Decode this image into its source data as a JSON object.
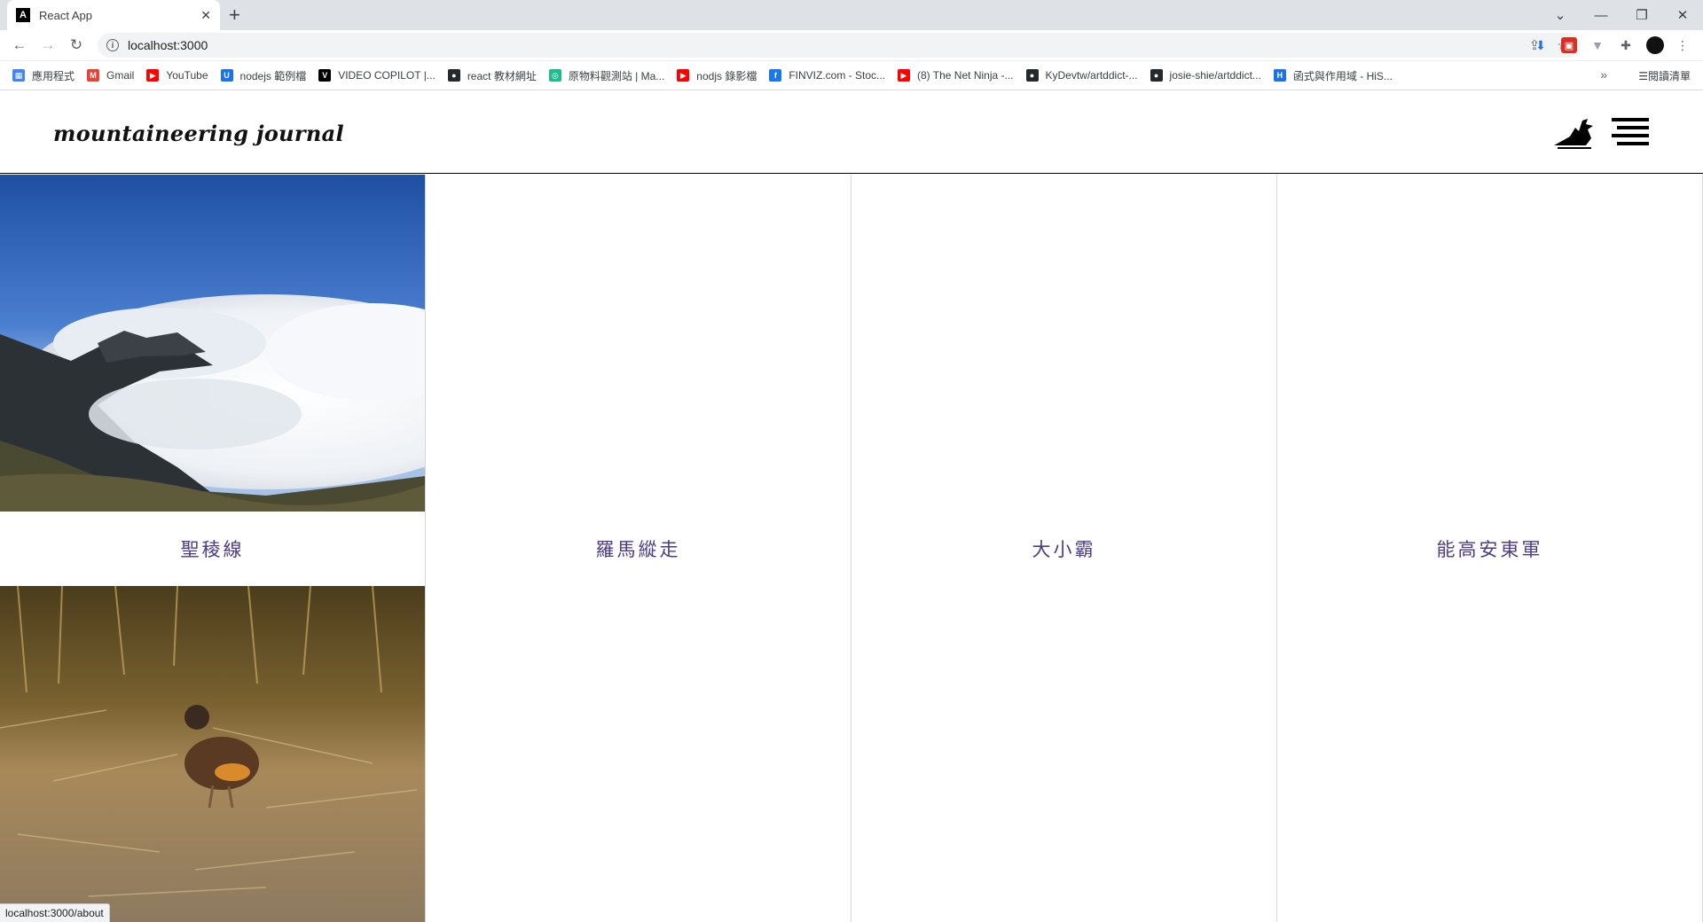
{
  "browser": {
    "tab_title": "React App",
    "tab_favicon_letter": "A",
    "url": "localhost:3000",
    "bookmarks": [
      {
        "label": "應用程式",
        "icon": "apps-grid-icon",
        "color": "#4285f4"
      },
      {
        "label": "Gmail",
        "icon": "gmail-icon",
        "color": "#ea4335"
      },
      {
        "label": "YouTube",
        "icon": "youtube-icon",
        "color": "#ff0000"
      },
      {
        "label": "nodejs 範例檔",
        "icon": "u-icon",
        "color": "#1a73e8"
      },
      {
        "label": "VIDEO COPILOT |...",
        "icon": "v-logo-icon",
        "color": "#000000"
      },
      {
        "label": "react 教材網址",
        "icon": "github-icon",
        "color": "#24292e"
      },
      {
        "label": "原物料觀測站 | Ma...",
        "icon": "ma-icon",
        "color": "#1ebc8c"
      },
      {
        "label": "nodjs 錄影檔",
        "icon": "youtube-icon",
        "color": "#ff0000"
      },
      {
        "label": "FINVIZ.com - Stoc...",
        "icon": "facebook-icon",
        "color": "#1877f2"
      },
      {
        "label": "(8) The Net Ninja -...",
        "icon": "youtube-icon",
        "color": "#ff0000"
      },
      {
        "label": "KyDevtw/artddict-...",
        "icon": "github-icon",
        "color": "#24292e"
      },
      {
        "label": "josie-shie/artddict...",
        "icon": "github-icon",
        "color": "#24292e"
      },
      {
        "label": "函式與作用域 - HiS...",
        "icon": "h-icon",
        "color": "#1a73e8"
      }
    ],
    "reading_list_label": "閱讀清單",
    "status_url": "localhost:3000/about"
  },
  "site": {
    "logo_text": "mountaineering journal"
  },
  "cards": [
    {
      "title": "聖稜線"
    },
    {
      "title": "羅馬縱走"
    },
    {
      "title": "大小霸"
    },
    {
      "title": "能高安東軍"
    }
  ]
}
